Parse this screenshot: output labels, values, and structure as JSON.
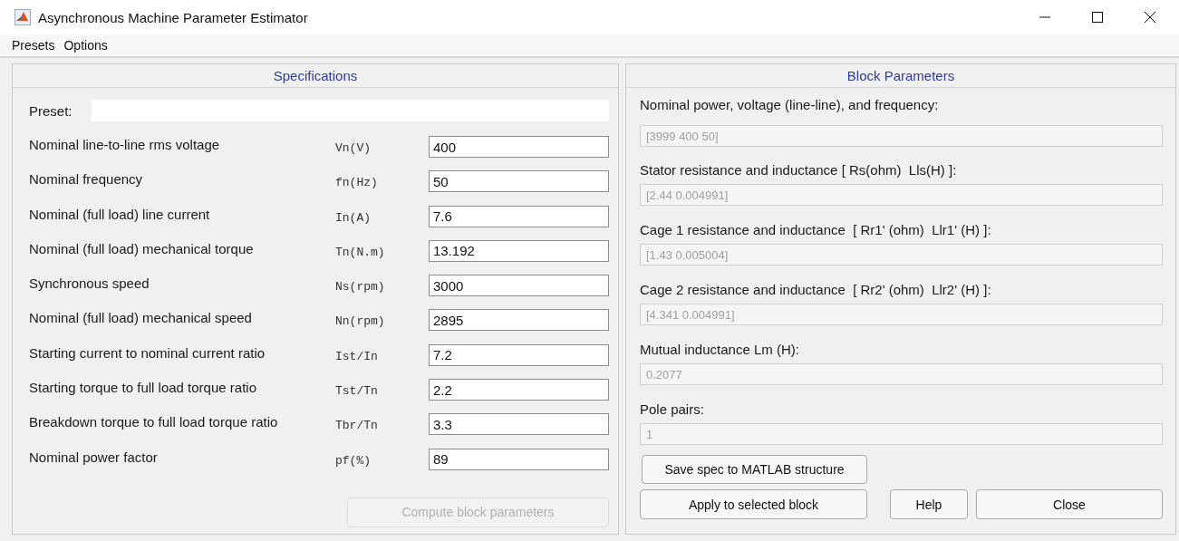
{
  "window": {
    "title": "Asynchronous Machine Parameter Estimator"
  },
  "menu": [
    {
      "label": "Presets"
    },
    {
      "label": "Options"
    }
  ],
  "specifications": {
    "title": "Specifications",
    "preset_label": "Preset:",
    "rows": [
      {
        "label": "Nominal line-to-line rms voltage",
        "symbol": "Vn(V)",
        "value": "400"
      },
      {
        "label": "Nominal frequency",
        "symbol": "fn(Hz)",
        "value": "50"
      },
      {
        "label": "Nominal (full load) line current",
        "symbol": "In(A)",
        "value": "7.6"
      },
      {
        "label": "Nominal (full load) mechanical torque",
        "symbol": "Tn(N.m)",
        "value": "13.192"
      },
      {
        "label": "Synchronous speed",
        "symbol": "Ns(rpm)",
        "value": "3000"
      },
      {
        "label": "Nominal (full load) mechanical speed",
        "symbol": "Nn(rpm)",
        "value": "2895"
      },
      {
        "label": "Starting current to nominal current ratio",
        "symbol": "Ist/In",
        "value": "7.2"
      },
      {
        "label": "Starting torque to full load torque ratio",
        "symbol": "Tst/Tn",
        "value": "2.2"
      },
      {
        "label": "Breakdown torque to full load torque ratio",
        "symbol": "Tbr/Tn",
        "value": "3.3"
      },
      {
        "label": "Nominal power factor",
        "symbol": "pf(%)",
        "value": "89"
      }
    ],
    "compute_button": {
      "label": "Compute block parameters",
      "disabled": true
    }
  },
  "block_parameters": {
    "title": "Block Parameters",
    "fields": [
      {
        "label": "Nominal power, voltage (line-line), and frequency:",
        "value": "[3999 400 50]",
        "disabled": true
      },
      {
        "label": "Stator resistance and inductance [ Rs(ohm)  Lls(H) ]:",
        "value": "[2.44 0.004991]",
        "disabled": true
      },
      {
        "label": "Cage 1 resistance and inductance  [ Rr1' (ohm)  Llr1' (H) ]:",
        "value": "[1.43 0.005004]",
        "disabled": true
      },
      {
        "label": "Cage 2 resistance and inductance  [ Rr2' (ohm)  Llr2' (H) ]:",
        "value": "[4.341 0.004991]",
        "disabled": true
      },
      {
        "label": "Mutual inductance Lm (H):",
        "value": "0.2077",
        "disabled": true
      },
      {
        "label": "Pole pairs:",
        "value": "1",
        "disabled": true
      }
    ],
    "buttons": [
      {
        "label": "Save spec to MATLAB structure",
        "disabled": false
      },
      {
        "label": "Apply to selected block",
        "disabled": false
      },
      {
        "label": "Help",
        "disabled": false
      },
      {
        "label": "Close",
        "disabled": false
      }
    ]
  }
}
